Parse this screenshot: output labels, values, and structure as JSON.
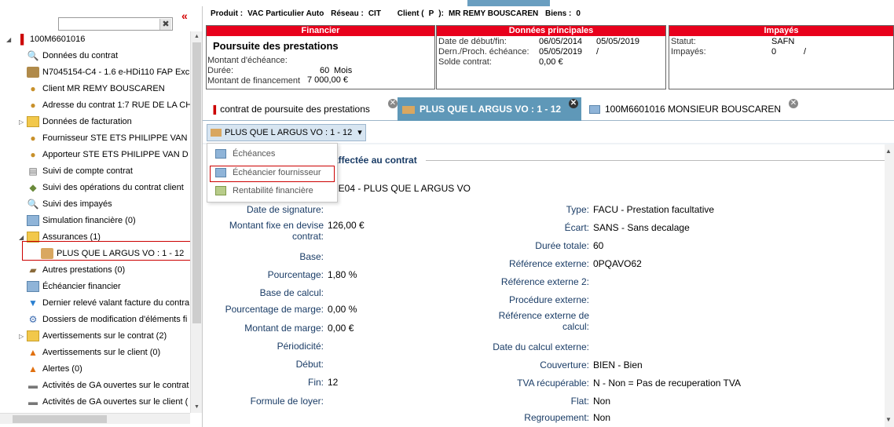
{
  "sidebar": {
    "collapse_label": "«",
    "search_clear_label": "✖",
    "items": [
      {
        "label": "100M6601016",
        "icon": "contract-icon"
      },
      {
        "label": "Données du contrat",
        "icon": "search-icon"
      },
      {
        "label": "N7045154-C4 - 1.6 e-HDi110 FAP Exc",
        "icon": "car-icon"
      },
      {
        "label": "Client MR REMY BOUSCAREN",
        "icon": "person-icon"
      },
      {
        "label": "Adresse du contrat 1:7 RUE DE LA CH",
        "icon": "person-icon"
      },
      {
        "label": "Données de facturation",
        "icon": "folder-icon"
      },
      {
        "label": "Fournisseur STE ETS PHILIPPE VAN",
        "icon": "person-icon"
      },
      {
        "label": "Apporteur STE ETS PHILIPPE VAN D",
        "icon": "person-icon"
      },
      {
        "label": "Suivi de compte contrat",
        "icon": "book-icon"
      },
      {
        "label": "Suivi des opérations du contrat client",
        "icon": "operations-icon"
      },
      {
        "label": "Suivi des impayés",
        "icon": "search-icon"
      },
      {
        "label": "Simulation financière (0)",
        "icon": "calculator-icon"
      },
      {
        "label": "Assurances (1)",
        "icon": "folder-icon"
      },
      {
        "label": "PLUS QUE L ARGUS VO : 1 - 12",
        "icon": "insurance-icon"
      },
      {
        "label": "Autres prestations (0)",
        "icon": "service-icon"
      },
      {
        "label": "Échéancier financier",
        "icon": "schedule-icon"
      },
      {
        "label": "Dernier relevé valant facture du contra",
        "icon": "invoice-icon"
      },
      {
        "label": "Dossiers de modification d'éléments fi",
        "icon": "settings-icon"
      },
      {
        "label": "Avertissements sur le contrat (2)",
        "icon": "folder-icon"
      },
      {
        "label": "Avertissements sur le client (0)",
        "icon": "warning-icon"
      },
      {
        "label": "Alertes (0)",
        "icon": "warning-icon"
      },
      {
        "label": "Activités de GA ouvertes sur le contrat",
        "icon": "activity-icon"
      },
      {
        "label": "Activités de GA ouvertes sur le client (",
        "icon": "activity-icon"
      }
    ]
  },
  "header": {
    "produit_label": "Produit :",
    "produit_value": "VAC Particulier Auto",
    "reseau_label": "Réseau :",
    "reseau_value": "CIT",
    "client_label": "Client (",
    "client_code": "P",
    "client_close": "):",
    "client_name": "MR REMY BOUSCAREN",
    "biens_label": "Biens :",
    "biens_value": "0"
  },
  "panels": {
    "financier": {
      "title": "Financier",
      "heading": "Poursuite des prestations",
      "montant_echeance_label": "Montant d'échéance:",
      "duree_label": "Durée:",
      "duree_value": "60",
      "duree_unit": "Mois",
      "montant_fin_label": "Montant de financement",
      "montant_fin_value": "7 000,00 €"
    },
    "principales": {
      "title": "Données principales",
      "date_label": "Date de début/fin:",
      "date_debut": "06/05/2014",
      "date_fin": "05/05/2019",
      "echeance_label": "Dern./Proch. échéance:",
      "echeance_dern": "05/05/2019",
      "echeance_sep": "/",
      "solde_label": "Solde contrat:",
      "solde_value": "0,00 €"
    },
    "impayes": {
      "title": "Impayés",
      "statut_label": "Statut:",
      "statut_value": "SAFN",
      "impayes_label": "Impayés:",
      "impayes_value": "0",
      "impayes_sep": "/"
    }
  },
  "tabs": [
    {
      "label": "contrat de poursuite des prestations",
      "active": false
    },
    {
      "label": "PLUS QUE L ARGUS VO : 1 - 12",
      "active": true
    },
    {
      "label": "100M6601016 MONSIEUR BOUSCAREN",
      "active": false
    }
  ],
  "tab_close": "✕",
  "dropdown": {
    "label": "PLUS QUE L ARGUS VO : 1 - 12",
    "caret": "▾",
    "items": [
      "Échéances",
      "Échéancier fournisseur",
      "Rentabilité financière"
    ]
  },
  "content": {
    "section_title": "affectée au contrat",
    "product_line": "2E04 - PLUS QUE L ARGUS VO",
    "left_fields": [
      {
        "label": "Date de signature:",
        "value": ""
      },
      {
        "label": "Montant fixe en devise",
        "label2": "contrat:",
        "value": "126,00 €"
      },
      {
        "label": "Base:",
        "value": ""
      },
      {
        "label": "Pourcentage:",
        "value": "1,80 %"
      },
      {
        "label": "Base de calcul:",
        "value": ""
      },
      {
        "label": "Pourcentage de marge:",
        "value": "0,00 %"
      },
      {
        "label": "Montant de marge:",
        "value": "0,00 €"
      },
      {
        "label": "Périodicité:",
        "value": ""
      },
      {
        "label": "Début:",
        "value": ""
      },
      {
        "label": "Fin:",
        "value": "12"
      },
      {
        "label": "Formule de loyer:",
        "value": ""
      }
    ],
    "right_fields": [
      {
        "label": "Type:",
        "value": "FACU - Prestation facultative"
      },
      {
        "label": "Écart:",
        "value": "SANS - Sans decalage"
      },
      {
        "label": "Durée totale:",
        "value": "60"
      },
      {
        "label": "Référence externe:",
        "value": "0PQAVO62"
      },
      {
        "label": "Référence externe 2:",
        "value": ""
      },
      {
        "label": "Procédure externe:",
        "value": ""
      },
      {
        "label": "Référence externe de",
        "label2": "calcul:",
        "value": ""
      },
      {
        "label": "Date du calcul externe:",
        "value": ""
      },
      {
        "label": "Couverture:",
        "value": "BIEN - Bien"
      },
      {
        "label": "TVA récupérable:",
        "value": "N - Non = Pas de recuperation TVA"
      },
      {
        "label": "Flat:",
        "value": "Non"
      },
      {
        "label": "Regroupement:",
        "value": "Non"
      }
    ]
  },
  "colors": {
    "brand_red": "#e8001c",
    "tab_active": "#5f98b8",
    "label_blue": "#1a3c66"
  }
}
